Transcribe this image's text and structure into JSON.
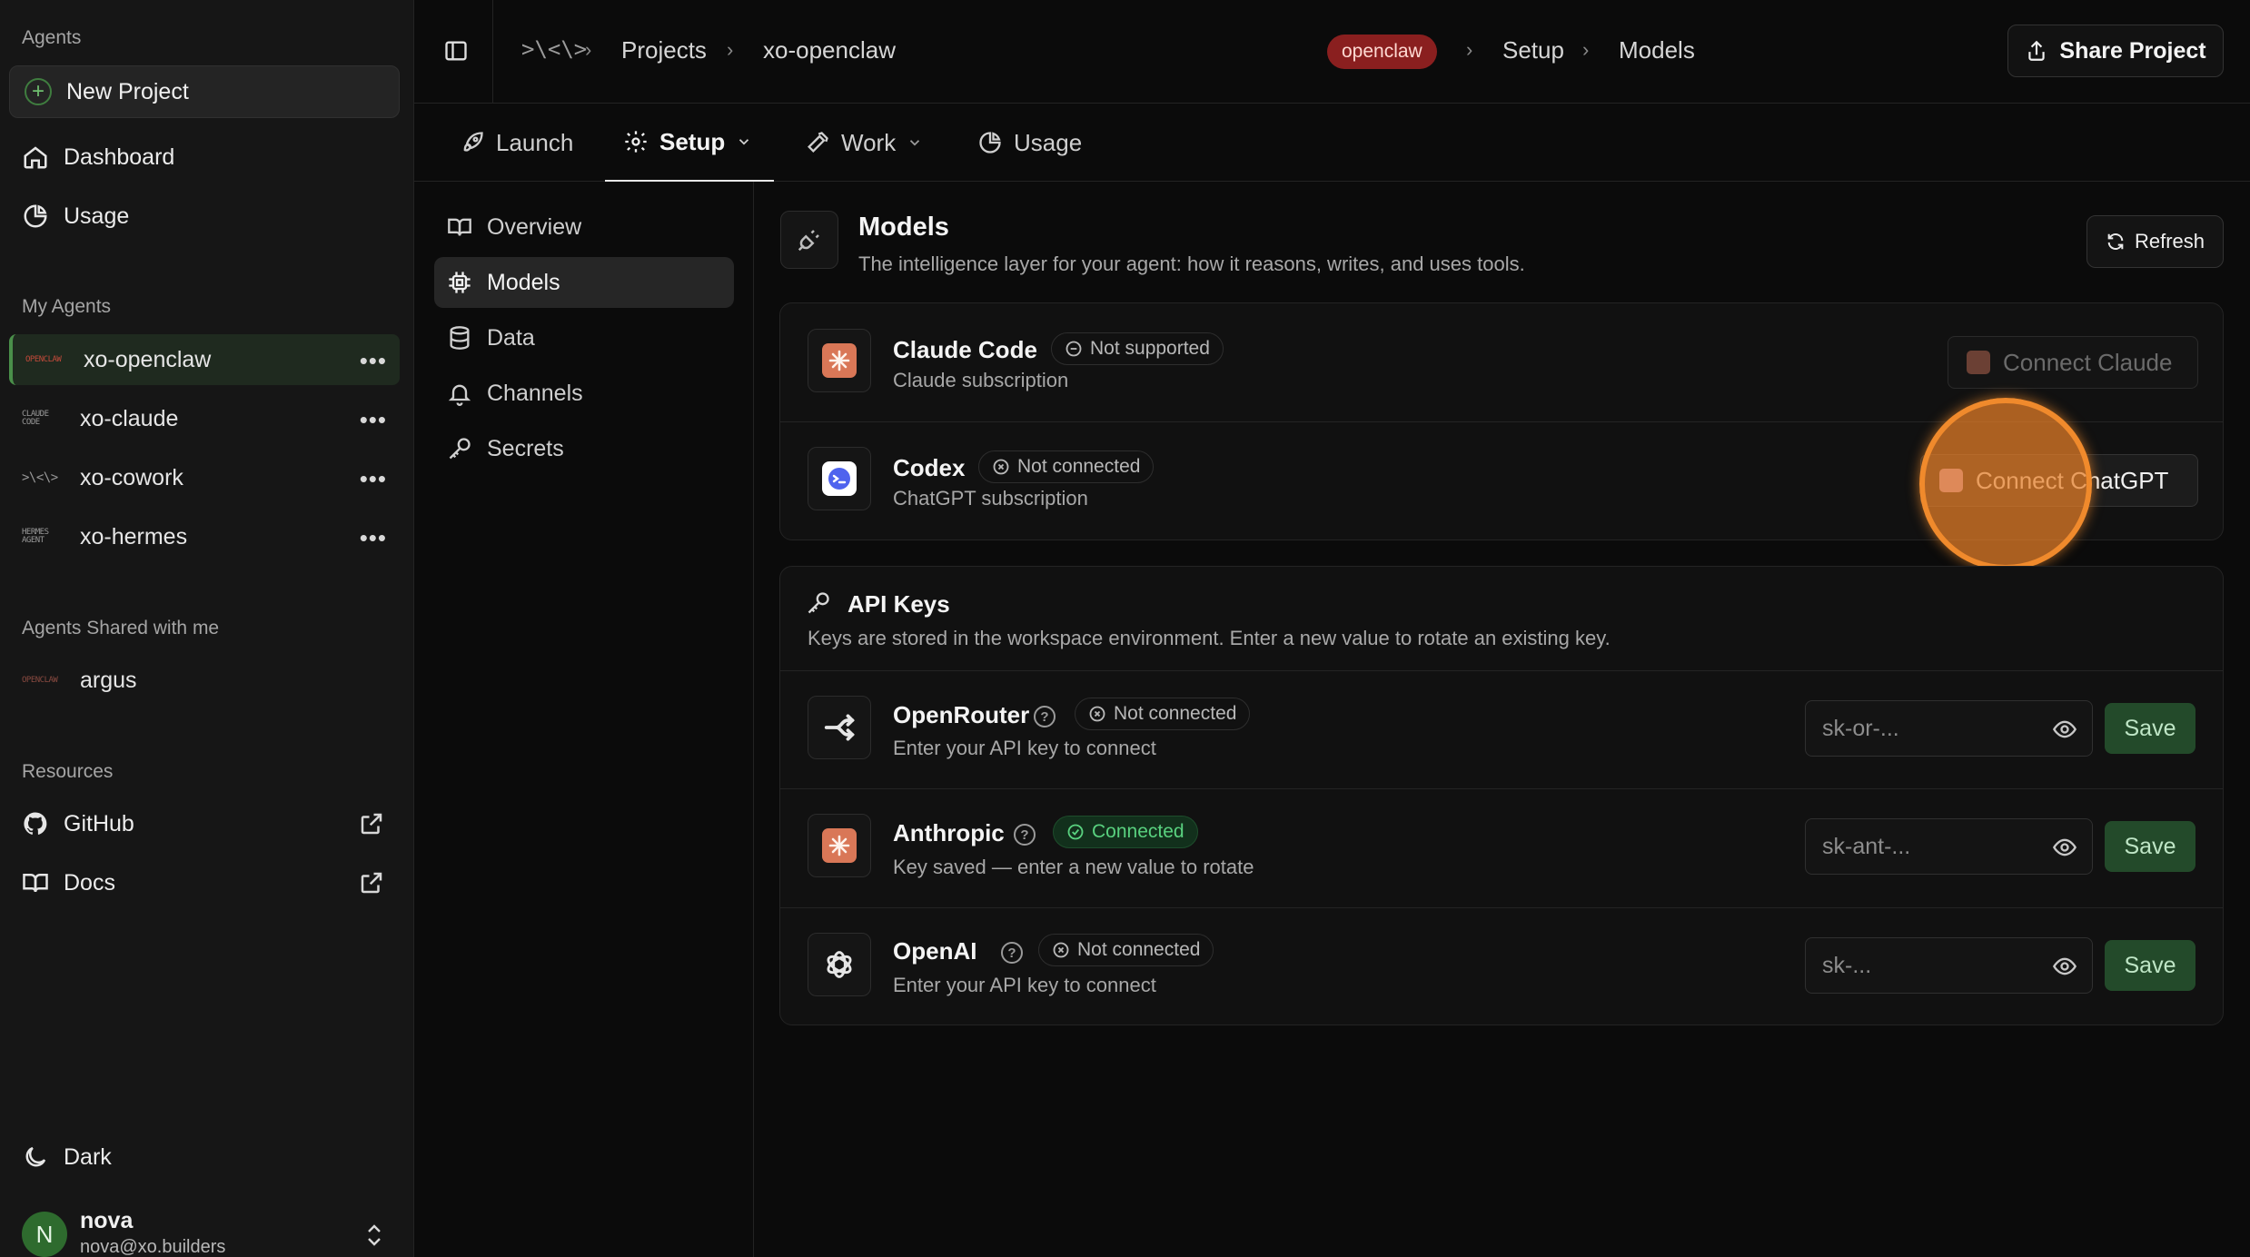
{
  "sidebar": {
    "agents_label": "Agents",
    "new_project": "New Project",
    "nav": [
      {
        "label": "Dashboard",
        "icon": "home-icon"
      },
      {
        "label": "Usage",
        "icon": "pie-chart-icon"
      }
    ],
    "my_agents_label": "My Agents",
    "my_agents": [
      {
        "name": "xo-openclaw",
        "logo": "OPENCLAW",
        "active": true
      },
      {
        "name": "xo-claude",
        "logo": "CLAUDE CODE",
        "active": false
      },
      {
        "name": "xo-cowork",
        "logo": ">\\<\\>",
        "active": false
      },
      {
        "name": "xo-hermes",
        "logo": "HERMES AGENT",
        "active": false
      }
    ],
    "shared_label": "Agents Shared with me",
    "shared_agents": [
      {
        "name": "argus",
        "logo": "OPENCLAW"
      }
    ],
    "resources_label": "Resources",
    "resources": [
      {
        "label": "GitHub",
        "icon": "github-icon"
      },
      {
        "label": "Docs",
        "icon": "book-icon"
      }
    ],
    "theme_label": "Dark",
    "user": {
      "initial": "N",
      "name": "nova",
      "email": "nova@xo.builders"
    }
  },
  "breadcrumb": {
    "logo": ">\\<\\>",
    "items": [
      "Projects",
      "xo-openclaw",
      "Setup",
      "Models"
    ],
    "badge": "openclaw"
  },
  "share_button": "Share Project",
  "tabs": [
    {
      "label": "Launch",
      "icon": "rocket-icon",
      "active": false,
      "dropdown": false
    },
    {
      "label": "Setup",
      "icon": "gear-icon",
      "active": true,
      "dropdown": true
    },
    {
      "label": "Work",
      "icon": "hammer-icon",
      "active": false,
      "dropdown": true
    },
    {
      "label": "Usage",
      "icon": "pie-chart-icon",
      "active": false,
      "dropdown": false
    }
  ],
  "subnav": [
    {
      "label": "Overview",
      "icon": "book-open-icon",
      "active": false
    },
    {
      "label": "Models",
      "icon": "cpu-icon",
      "active": true
    },
    {
      "label": "Data",
      "icon": "database-icon",
      "active": false
    },
    {
      "label": "Channels",
      "icon": "bell-icon",
      "active": false
    },
    {
      "label": "Secrets",
      "icon": "key-icon",
      "active": false
    }
  ],
  "models": {
    "title": "Models",
    "description": "The intelligence layer for your agent: how it reasons, writes, and uses tools.",
    "refresh": "Refresh",
    "subscriptions": [
      {
        "name": "Claude Code",
        "status": "Not supported",
        "subtitle": "Claude subscription",
        "button": "Connect Claude",
        "accent": "#d97757"
      },
      {
        "name": "Codex",
        "status": "Not connected",
        "subtitle": "ChatGPT subscription",
        "button": "Connect ChatGPT",
        "accent": "#5b6cf0"
      }
    ]
  },
  "api_keys": {
    "title": "API Keys",
    "description": "Keys are stored in the workspace environment. Enter a new value to rotate an existing key.",
    "providers": [
      {
        "name": "OpenRouter",
        "status": "Not connected",
        "connected": false,
        "subtitle": "Enter your API key to connect",
        "placeholder": "sk-or-...",
        "save": "Save"
      },
      {
        "name": "Anthropic",
        "status": "Connected",
        "connected": true,
        "subtitle": "Key saved — enter a new value to rotate",
        "placeholder": "sk-ant-...",
        "save": "Save"
      },
      {
        "name": "OpenAI",
        "status": "Not connected",
        "connected": false,
        "subtitle": "Enter your API key to connect",
        "placeholder": "sk-...",
        "save": "Save"
      }
    ]
  },
  "colors": {
    "accent_green": "#4a8f4a",
    "badge_red": "#8a1f1f",
    "click_highlight": "#f08a2c"
  }
}
